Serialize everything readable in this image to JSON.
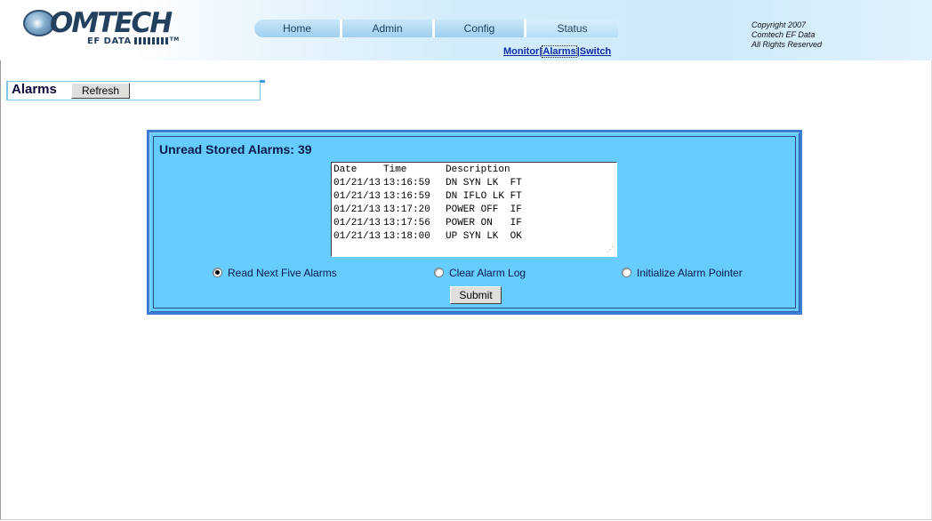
{
  "brand": {
    "logo_text": "OMTECH",
    "logo_sub": "EF DATA"
  },
  "nav": {
    "tabs": [
      {
        "label": "Home"
      },
      {
        "label": "Admin"
      },
      {
        "label": "Config"
      },
      {
        "label": "Status",
        "active": true
      }
    ]
  },
  "subnav": {
    "items": [
      "Monitor",
      "Alarms",
      "Switch"
    ],
    "active": "Alarms"
  },
  "copyright": {
    "line1": "Copyright 2007",
    "line2": "Comtech EF Data",
    "line3": "All Rights Reserved"
  },
  "page": {
    "title": "Alarms",
    "refresh_label": "Refresh"
  },
  "alarms": {
    "unread_label": "Unread Stored Alarms:",
    "unread_count": "39",
    "columns": [
      "Date",
      "Time",
      "Description"
    ],
    "rows": [
      {
        "date": "01/21/13",
        "time": "13:16:59",
        "desc": "DN SYN LK  FT"
      },
      {
        "date": "01/21/13",
        "time": "13:16:59",
        "desc": "DN IFLO LK FT"
      },
      {
        "date": "01/21/13",
        "time": "13:17:20",
        "desc": "POWER OFF  IF"
      },
      {
        "date": "01/21/13",
        "time": "13:17:56",
        "desc": "POWER ON   IF"
      },
      {
        "date": "01/21/13",
        "time": "13:18:00",
        "desc": "UP SYN LK  OK"
      }
    ],
    "options": [
      {
        "label": "Read Next Five Alarms",
        "checked": true
      },
      {
        "label": "Clear Alarm Log",
        "checked": false
      },
      {
        "label": "Initialize Alarm Pointer",
        "checked": false
      }
    ],
    "submit_label": "Submit"
  },
  "colors": {
    "panel_bg": "#66ccfd",
    "panel_border": "#3b7dd3",
    "link": "#0b2aa8",
    "title": "#0b0b3b"
  }
}
